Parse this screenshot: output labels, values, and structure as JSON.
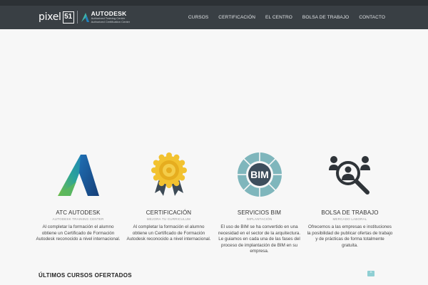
{
  "brand": {
    "pixel_text": "pixel",
    "pixel_num": "51",
    "partner_name": "AUTODESK",
    "partner_line1": "Authorized Training Center",
    "partner_line2": "Authorized Certification Center"
  },
  "nav": {
    "items": [
      "CURSOS",
      "CERTIFICACIÓN",
      "EL CENTRO",
      "BOLSA DE TRABAJO",
      "CONTACTO"
    ]
  },
  "features": [
    {
      "icon": "autodesk-logo-icon",
      "title": "ATC AUTODESK",
      "subtitle": "AUTODESK TRAINING CENTER",
      "desc": "Al completar la formación el alumno obtiene un Certificado de Formación Autodesk reconocido a nivel internacional."
    },
    {
      "icon": "certificate-medal-icon",
      "title": "CERTIFICACIÓN",
      "subtitle": "MEJORA TU CURRICULUM",
      "desc": "Al completar la formación el alumno obtiene un Certificado de Formación Autodesk reconocido a nivel internacional."
    },
    {
      "icon": "bim-cycle-icon",
      "icon_label": "BIM",
      "title": "SERVICIOS BIM",
      "subtitle": "IMPLANTACIÓN",
      "desc": "El uso de BIM se ha convertido en una necesidad en el sector de la arquitectura. Le guiamos en cada una de las fases del proceso de implantación de BIM en su empresa."
    },
    {
      "icon": "job-search-icon",
      "title": "BOLSA DE TRABAJO",
      "subtitle": "MERCADO LABORAL",
      "desc": "Ofrecemos a las empresas e instituciones la posibilidad de publicar ofertas de trabajo y de prácticas de forma totalmente gratuita."
    }
  ],
  "latest_courses_heading": "ÚLTIMOS CURSOS OFERTADOS",
  "scroll_top_glyph": "^",
  "colors": {
    "header": "#393f44",
    "topbar": "#2c3135",
    "accent": "#8fcfd3"
  }
}
